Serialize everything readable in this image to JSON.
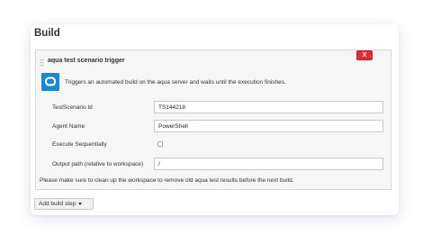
{
  "section": {
    "title": "Build"
  },
  "step": {
    "title": "aqua test scenario trigger",
    "delete_label": "X",
    "logo_icon": "aqua-logo-icon",
    "description": "Triggers an automated build on the aqua server and waits until the execution finishes.",
    "fields": {
      "scenario_id": {
        "label": "TestScenario Id",
        "value": "TS144218"
      },
      "agent_name": {
        "label": "Agent Name",
        "value": "PowerShell"
      },
      "execute_sequentially": {
        "label": "Execute Sequentially",
        "checked": false
      },
      "output_path": {
        "label": "Output path (relative to workspace)",
        "value": "/"
      }
    },
    "note": "Please make sure to clean up the workspace to remove old aqua test results before the next build."
  },
  "add_build_step": {
    "label": "Add build step"
  },
  "colors": {
    "accent": "#1c88d5",
    "delete": "#d9322f"
  }
}
